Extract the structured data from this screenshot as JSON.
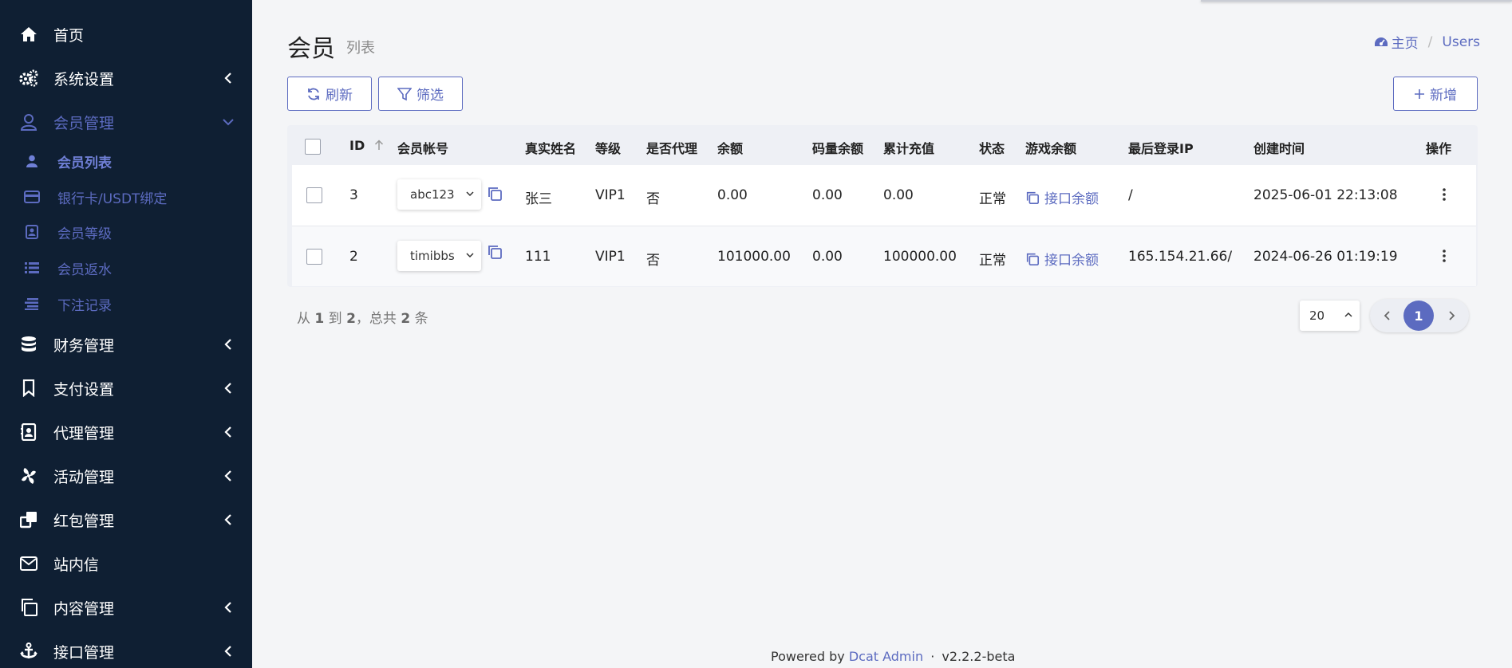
{
  "sidebar": {
    "items": [
      {
        "label": "首页",
        "icon": "home-icon"
      },
      {
        "label": "系统设置",
        "icon": "gears-icon"
      },
      {
        "label": "会员管理",
        "icon": "user-icon"
      },
      {
        "label": "财务管理",
        "icon": "database-icon"
      },
      {
        "label": "支付设置",
        "icon": "bookmark-icon"
      },
      {
        "label": "代理管理",
        "icon": "contact-card-icon"
      },
      {
        "label": "活动管理",
        "icon": "pinwheel-icon"
      },
      {
        "label": "红包管理",
        "icon": "clone-icon"
      },
      {
        "label": "站内信",
        "icon": "envelope-icon"
      },
      {
        "label": "内容管理",
        "icon": "copy-icon"
      },
      {
        "label": "接口管理",
        "icon": "anchor-icon"
      }
    ],
    "sub_items": [
      {
        "label": "会员列表",
        "icon": "user-small-icon"
      },
      {
        "label": "银行卡/USDT绑定",
        "icon": "credit-card-icon"
      },
      {
        "label": "会员等级",
        "icon": "id-badge-icon"
      },
      {
        "label": "会员返水",
        "icon": "list-icon"
      },
      {
        "label": "下注记录",
        "icon": "align-icon"
      }
    ]
  },
  "header": {
    "title": "会员",
    "subtitle": "列表",
    "breadcrumb": {
      "home": "主页",
      "current": "Users"
    }
  },
  "toolbar": {
    "refresh_label": "刷新",
    "filter_label": "筛选",
    "add_label": "新增"
  },
  "table": {
    "columns": [
      "ID",
      "会员帐号",
      "真实姓名",
      "等级",
      "是否代理",
      "余额",
      "码量余额",
      "累计充值",
      "状态",
      "游戏余额",
      "最后登录IP",
      "创建时间",
      "操作"
    ],
    "rows": [
      {
        "id": "3",
        "account": "abc123",
        "real_name": "张三",
        "level": "VIP1",
        "is_agent": "否",
        "balance": "0.00",
        "code_balance": "0.00",
        "total_recharge": "0.00",
        "status": "正常",
        "game_balance": "接口余额",
        "last_ip": "/",
        "created": "2025-06-01 22:13:08"
      },
      {
        "id": "2",
        "account": "timibbs",
        "real_name": "111",
        "level": "VIP1",
        "is_agent": "否",
        "balance": "101000.00",
        "code_balance": "0.00",
        "total_recharge": "100000.00",
        "status": "正常",
        "game_balance": "接口余额",
        "last_ip": "165.154.21.66/",
        "created": "2024-06-26 01:19:19"
      }
    ]
  },
  "pagination": {
    "summary": {
      "prefix": "从",
      "from": "1",
      "to_word": "到",
      "to": "2",
      "total_word": "，总共",
      "total": "2",
      "suffix": "条"
    },
    "page_size": "20",
    "current_page": "1"
  },
  "footer": {
    "powered_by": "Powered by",
    "brand": "Dcat Admin",
    "dot": "·",
    "version": "v2.2.2-beta"
  },
  "colors": {
    "sidebar_bg": "#0f1f33",
    "accent": "#5c6bc0",
    "page_bg": "#f4f5f7"
  }
}
